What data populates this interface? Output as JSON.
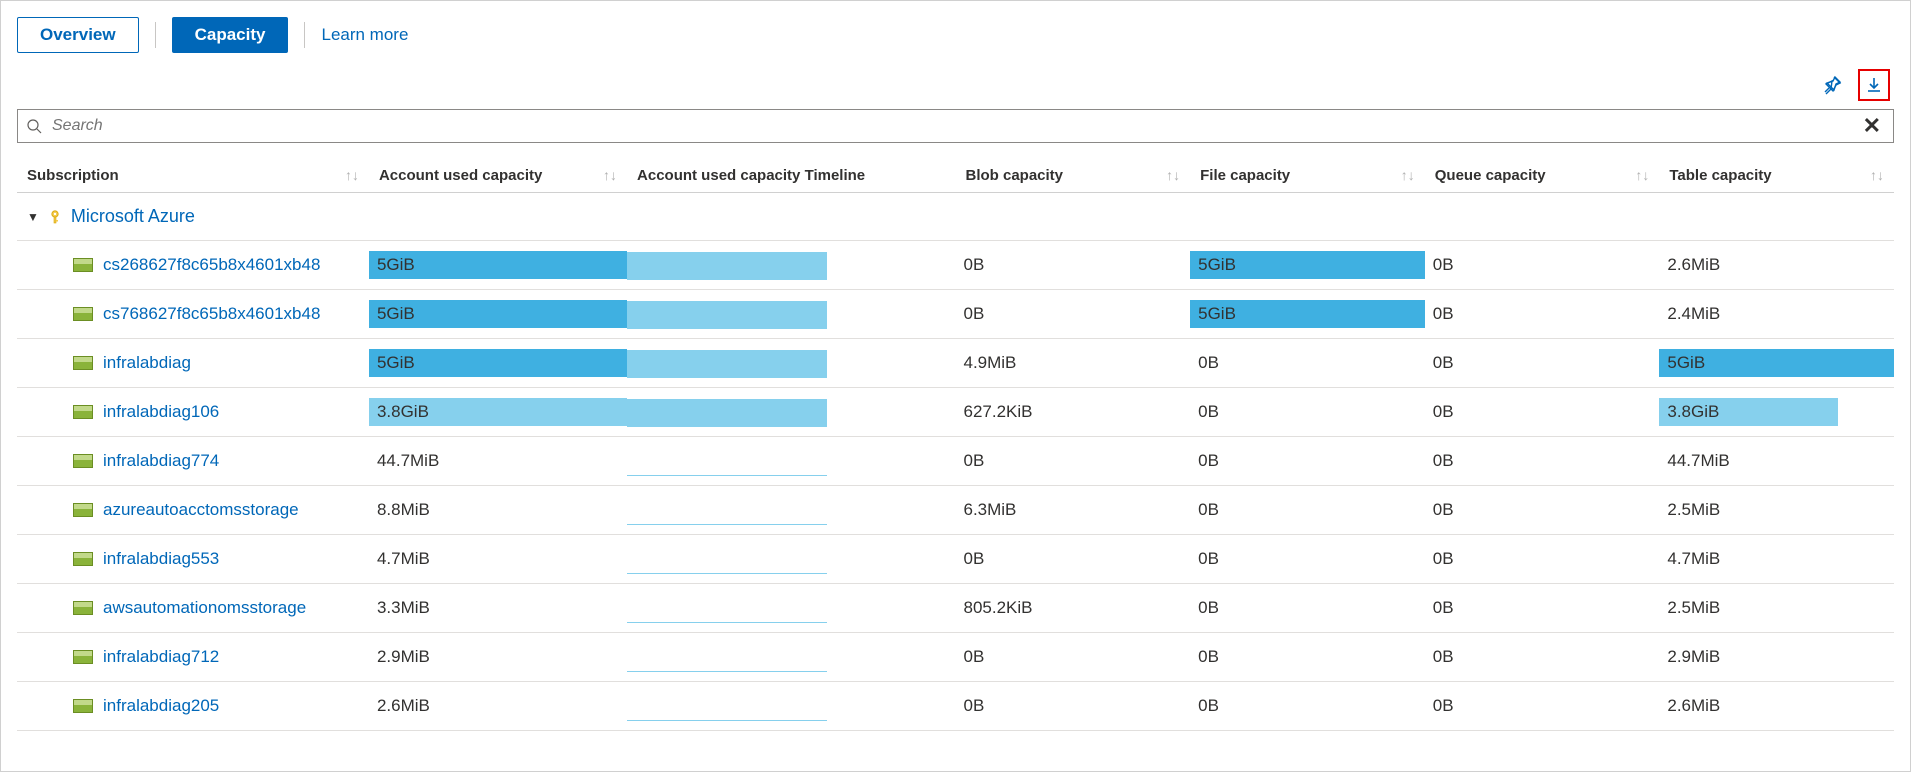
{
  "toolbar": {
    "overview": "Overview",
    "capacity": "Capacity",
    "learn_more": "Learn more"
  },
  "actions": {
    "pin_icon": "pin-icon",
    "download_icon": "download-icon"
  },
  "search": {
    "placeholder": "Search"
  },
  "columns": {
    "subscription": "Subscription",
    "account_used": "Account used capacity",
    "timeline": "Account used capacity Timeline",
    "blob": "Blob capacity",
    "file": "File capacity",
    "queue": "Queue capacity",
    "table": "Table capacity"
  },
  "group": {
    "name": "Microsoft Azure"
  },
  "rows": [
    {
      "name": "cs268627f8c65b8x4601xb48",
      "account_used": "5GiB",
      "account_pct": 100,
      "timeline_pct": 100,
      "blob": "0B",
      "blob_pct": 0,
      "file": "5GiB",
      "file_pct": 100,
      "queue": "0B",
      "queue_pct": 0,
      "table": "2.6MiB",
      "table_pct": 0
    },
    {
      "name": "cs768627f8c65b8x4601xb48",
      "account_used": "5GiB",
      "account_pct": 100,
      "timeline_pct": 100,
      "blob": "0B",
      "blob_pct": 0,
      "file": "5GiB",
      "file_pct": 100,
      "queue": "0B",
      "queue_pct": 0,
      "table": "2.4MiB",
      "table_pct": 0
    },
    {
      "name": "infralabdiag",
      "account_used": "5GiB",
      "account_pct": 100,
      "timeline_pct": 100,
      "blob": "4.9MiB",
      "blob_pct": 0,
      "file": "0B",
      "file_pct": 0,
      "queue": "0B",
      "queue_pct": 0,
      "table": "5GiB",
      "table_pct": 100
    },
    {
      "name": "infralabdiag106",
      "account_used": "3.8GiB",
      "account_pct": 100,
      "timeline_pct": 100,
      "blob": "627.2KiB",
      "blob_pct": 0,
      "file": "0B",
      "file_pct": 0,
      "queue": "0B",
      "queue_pct": 0,
      "table": "3.8GiB",
      "table_pct": 76,
      "table_light": true,
      "account_light": true
    },
    {
      "name": "infralabdiag774",
      "account_used": "44.7MiB",
      "account_pct": 0,
      "timeline_pct": 2,
      "blob": "0B",
      "blob_pct": 0,
      "file": "0B",
      "file_pct": 0,
      "queue": "0B",
      "queue_pct": 0,
      "table": "44.7MiB",
      "table_pct": 0
    },
    {
      "name": "azureautoacctomsstorage",
      "account_used": "8.8MiB",
      "account_pct": 0,
      "timeline_pct": 2,
      "blob": "6.3MiB",
      "blob_pct": 0,
      "file": "0B",
      "file_pct": 0,
      "queue": "0B",
      "queue_pct": 0,
      "table": "2.5MiB",
      "table_pct": 0
    },
    {
      "name": "infralabdiag553",
      "account_used": "4.7MiB",
      "account_pct": 0,
      "timeline_pct": 2,
      "blob": "0B",
      "blob_pct": 0,
      "file": "0B",
      "file_pct": 0,
      "queue": "0B",
      "queue_pct": 0,
      "table": "4.7MiB",
      "table_pct": 0
    },
    {
      "name": "awsautomationomsstorage",
      "account_used": "3.3MiB",
      "account_pct": 0,
      "timeline_pct": 2,
      "blob": "805.2KiB",
      "blob_pct": 0,
      "file": "0B",
      "file_pct": 0,
      "queue": "0B",
      "queue_pct": 0,
      "table": "2.5MiB",
      "table_pct": 0
    },
    {
      "name": "infralabdiag712",
      "account_used": "2.9MiB",
      "account_pct": 0,
      "timeline_pct": 2,
      "blob": "0B",
      "blob_pct": 0,
      "file": "0B",
      "file_pct": 0,
      "queue": "0B",
      "queue_pct": 0,
      "table": "2.9MiB",
      "table_pct": 0
    },
    {
      "name": "infralabdiag205",
      "account_used": "2.6MiB",
      "account_pct": 0,
      "timeline_pct": 2,
      "blob": "0B",
      "blob_pct": 0,
      "file": "0B",
      "file_pct": 0,
      "queue": "0B",
      "queue_pct": 0,
      "table": "2.6MiB",
      "table_pct": 0
    }
  ]
}
